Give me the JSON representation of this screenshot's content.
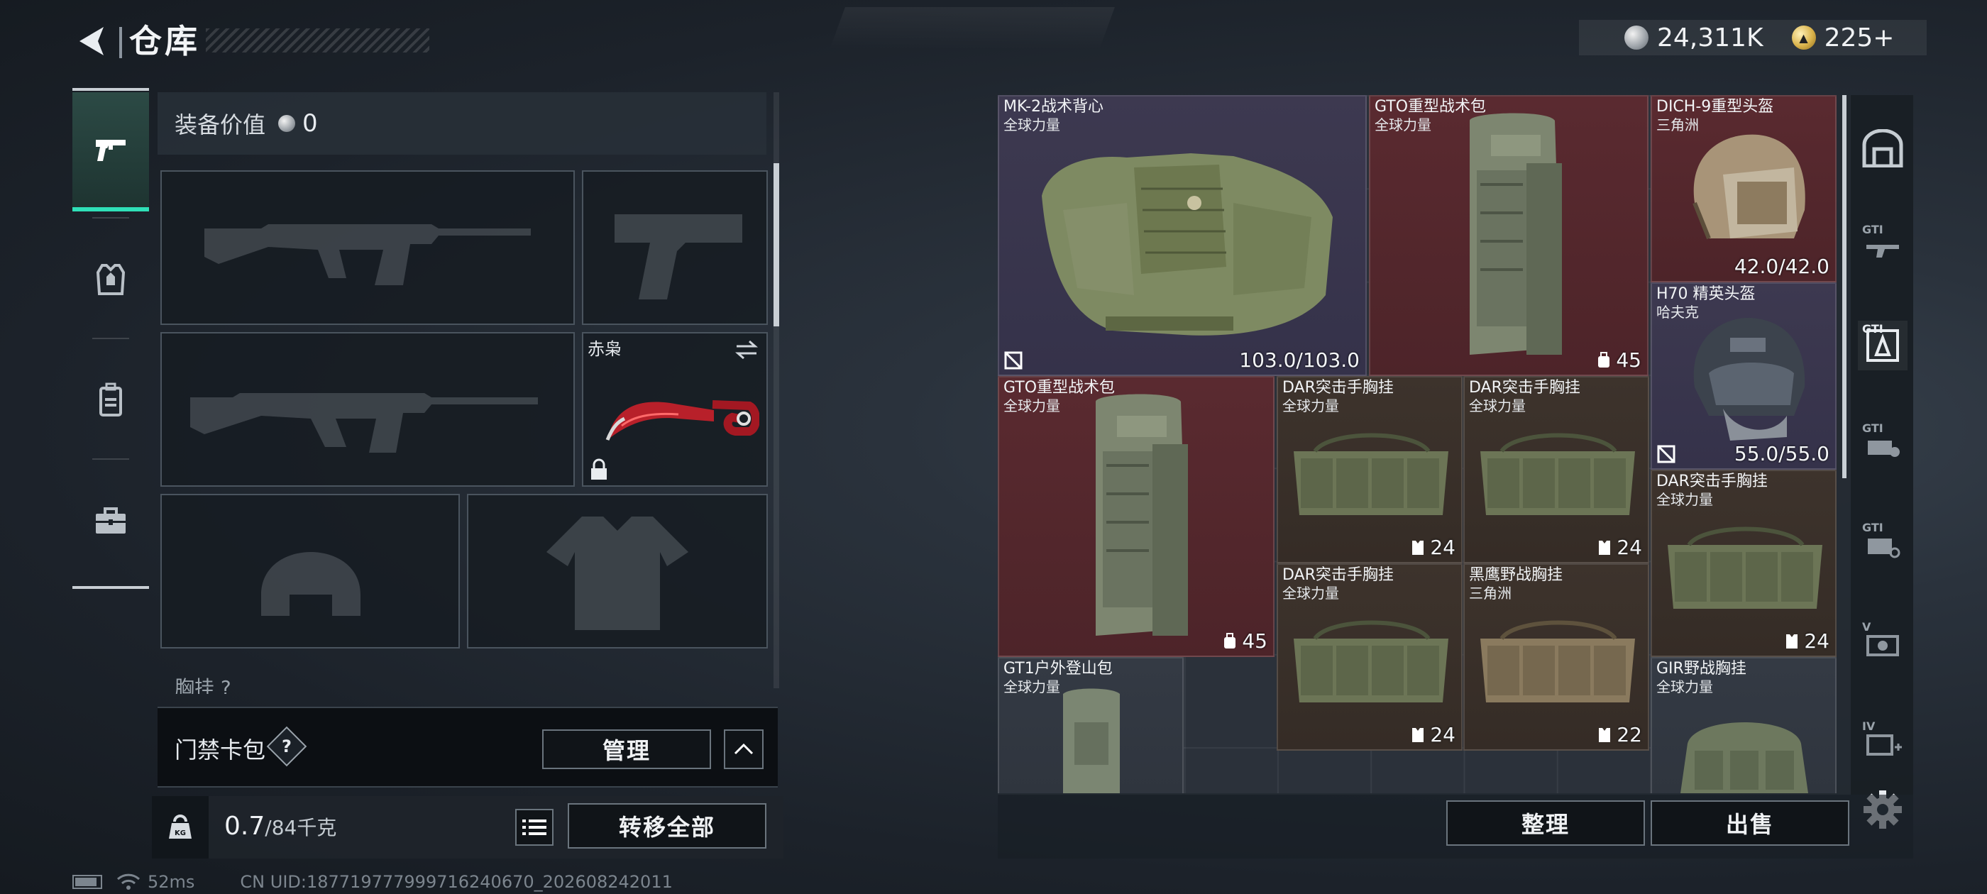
{
  "header": {
    "title": "仓库"
  },
  "currency": {
    "silver": "24,311K",
    "gold": "225+"
  },
  "loadout": {
    "value_label": "装备价值",
    "value": "0",
    "knife_name": "赤枭",
    "cut_label": "胸挂 ?",
    "access_card_label": "门禁卡包",
    "help": "?",
    "manage_button": "管理",
    "weight_value": "0.7",
    "weight_max": "/84千克",
    "transfer_button": "转移全部"
  },
  "stash": {
    "items": [
      {
        "name": "MK-2战术背心",
        "sub": "全球力量",
        "durability": "103.0/103.0"
      },
      {
        "name": "GTO重型战术包",
        "sub": "全球力量",
        "capacity": "45"
      },
      {
        "name": "DICH-9重型头盔",
        "sub": "三角洲",
        "durability": "42.0/42.0"
      },
      {
        "name": "H70 精英头盔",
        "sub": "哈夫克",
        "durability": "55.0/55.0"
      },
      {
        "name": "GTO重型战术包",
        "sub": "全球力量",
        "capacity": "45"
      },
      {
        "name": "DAR突击手胸挂",
        "sub": "全球力量",
        "capacity": "24"
      },
      {
        "name": "DAR突击手胸挂",
        "sub": "全球力量",
        "capacity": "24"
      },
      {
        "name": "DAR突击手胸挂",
        "sub": "全球力量",
        "capacity": "24"
      },
      {
        "name": "DAR突击手胸挂",
        "sub": "全球力量",
        "capacity": "24"
      },
      {
        "name": "黑鹰野战胸挂",
        "sub": "三角洲",
        "capacity": "22"
      },
      {
        "name": "GT1户外登山包",
        "sub": "全球力量"
      },
      {
        "name": "GIR野战胸挂",
        "sub": "全球力量"
      }
    ],
    "side_tabs": [
      "GTI",
      "GTI",
      "GTI",
      "GTI",
      "V",
      "IV"
    ],
    "sort_button": "整理",
    "sell_button": "出售"
  },
  "status": {
    "ping": "52ms",
    "uid": "CN UID:187719777999716240670_202608242011"
  },
  "colors": {
    "accent": "#2fe0b8",
    "rare_red": "#5a2a30",
    "epic_purple": "#3d3950",
    "brown": "#3d332c"
  }
}
